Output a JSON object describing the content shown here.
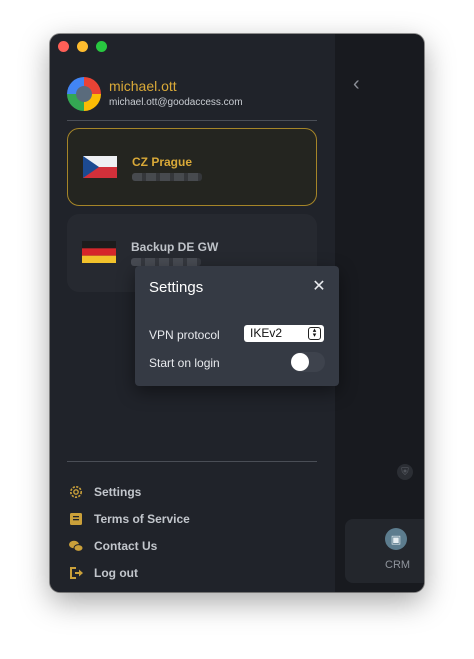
{
  "user": {
    "name": "michael.ott",
    "email": "michael.ott@goodaccess.com"
  },
  "gateways": [
    {
      "name": "CZ Prague",
      "country": "cz",
      "active": true,
      "name_color": "#d9a938"
    },
    {
      "name": "Backup DE GW",
      "country": "de",
      "active": false,
      "name_color": "#c2c6cc"
    }
  ],
  "menu": {
    "items": [
      {
        "label": "Settings",
        "icon": "gear-icon"
      },
      {
        "label": "Terms of Service",
        "icon": "book-icon"
      },
      {
        "label": "Contact Us",
        "icon": "chat-icon"
      },
      {
        "label": "Log out",
        "icon": "logout-icon"
      }
    ]
  },
  "dialog": {
    "title": "Settings",
    "vpn_protocol_label": "VPN protocol",
    "vpn_protocol_value": "IKEv2",
    "start_on_login_label": "Start on login",
    "start_on_login": false
  },
  "right_pane": {
    "crm_label": "CRM"
  },
  "colors": {
    "accent": "#d9a938",
    "window_bg": "#20232a",
    "dialog_bg": "#353a44"
  }
}
